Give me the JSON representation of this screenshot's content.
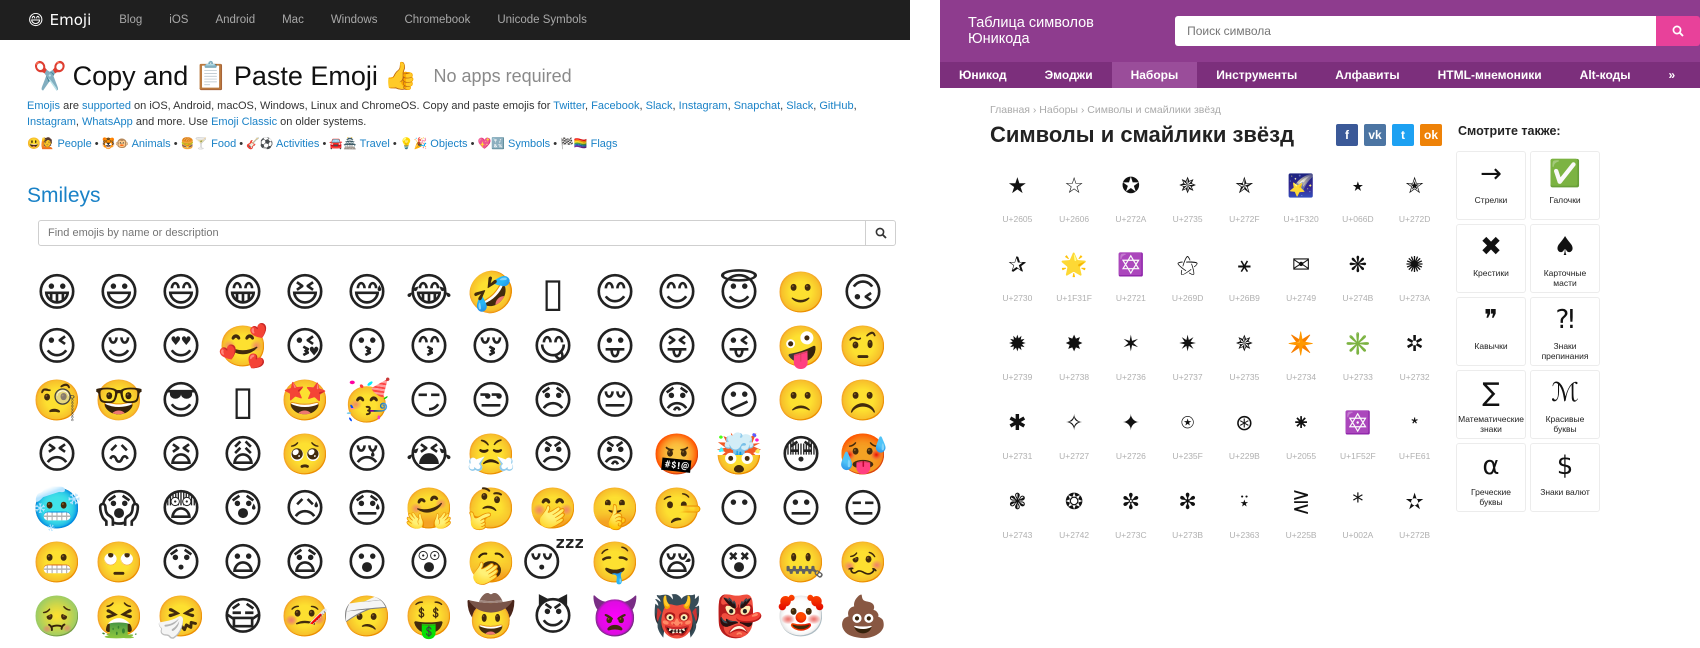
{
  "left": {
    "nav": {
      "brand_icon": "😄",
      "brand": "Emoji",
      "links": [
        "Blog",
        "iOS",
        "Android",
        "Mac",
        "Windows",
        "Chromebook",
        "Unicode Symbols"
      ]
    },
    "header": {
      "icon_scissors": "✂️",
      "word_copy": "Copy and",
      "icon_clipboard": "📋",
      "word_paste": "Paste Emoji",
      "icon_thumb": "👍",
      "note": "No apps required"
    },
    "intro": {
      "emojis": "Emojis",
      "are": " are ",
      "supported": "supported",
      "rest1": " on iOS, Android, macOS, Windows, Linux and ChromeOS. Copy and paste emojis for ",
      "links": [
        "Twitter",
        "Facebook",
        "Slack",
        "Instagram",
        "Snapchat",
        "Slack",
        "GitHub",
        "Instagram",
        "WhatsApp"
      ],
      "rest2": " and more. Use ",
      "classic": "Emoji Classic",
      "rest3": " on older systems."
    },
    "categories": [
      {
        "icons": "😃🙋",
        "label": "People"
      },
      {
        "icons": "🐯🐵",
        "label": "Animals"
      },
      {
        "icons": "🍔🍸",
        "label": "Food"
      },
      {
        "icons": "🎸⚽",
        "label": "Activities"
      },
      {
        "icons": "🚘🏯",
        "label": "Travel"
      },
      {
        "icons": "💡🎉",
        "label": "Objects"
      },
      {
        "icons": "💖🔣",
        "label": "Symbols"
      },
      {
        "icons": "🏁🏳️‍🌈",
        "label": "Flags"
      }
    ],
    "section_title": "Smileys",
    "search_placeholder": "Find emojis by name or description",
    "emoji_rows": [
      [
        "😀",
        "😃",
        "😄",
        "😁",
        "😆",
        "😅",
        "😂",
        "🤣",
        "▯",
        "😊",
        "😊",
        "😇",
        "🙂",
        "🙃"
      ],
      [
        "😉",
        "😌",
        "😍",
        "🥰",
        "😘",
        "😗",
        "😙",
        "😚",
        "😋",
        "😛",
        "😝",
        "😜",
        "🤪",
        "🤨"
      ],
      [
        "🧐",
        "🤓",
        "😎",
        "▯",
        "🤩",
        "🥳",
        "😏",
        "😒",
        "😞",
        "😔",
        "😟",
        "😕",
        "🙁",
        "☹️"
      ],
      [
        "😣",
        "😖",
        "😫",
        "😩",
        "🥺",
        "😢",
        "😭",
        "😤",
        "😠",
        "😡",
        "🤬",
        "🤯",
        "😳",
        "🥵"
      ],
      [
        "🥶",
        "😱",
        "😨",
        "😰",
        "😥",
        "😓",
        "🤗",
        "🤔",
        "🤭",
        "🤫",
        "🤥",
        "😶",
        "😐",
        "😑"
      ],
      [
        "😬",
        "🙄",
        "😯",
        "😦",
        "😧",
        "😮",
        "😲",
        "🥱",
        "😴",
        "🤤",
        "😪",
        "😵",
        "🤐",
        "🥴"
      ],
      [
        "🤢",
        "🤮",
        "🤧",
        "😷",
        "🤒",
        "🤕",
        "🤑",
        "🤠",
        "😈",
        "👿",
        "👹",
        "👺",
        "🤡",
        "💩"
      ]
    ]
  },
  "right": {
    "logo": "Таблица символов Юникода",
    "search_placeholder": "Поиск символа",
    "menu": [
      "Юникод",
      "Эмоджи",
      "Наборы",
      "Инструменты",
      "Алфавиты",
      "HTML-мнемоники",
      "Alt-коды",
      "»"
    ],
    "active_menu": "Наборы",
    "breadcrumbs": "Главная › Наборы › Символы и смайлики звёзд",
    "title": "Символы и смайлики звёзд",
    "social": [
      {
        "label": "f",
        "color": "#3b5998"
      },
      {
        "label": "vk",
        "color": "#4c75a3"
      },
      {
        "label": "t",
        "color": "#1da1f2"
      },
      {
        "label": "ok",
        "color": "#ee8208"
      }
    ],
    "symbol_rows": [
      [
        {
          "g": "★",
          "c": "U+2605"
        },
        {
          "g": "☆",
          "c": "U+2606"
        },
        {
          "g": "✪",
          "c": "U+272A"
        },
        {
          "g": "✵",
          "c": "U+2735"
        },
        {
          "g": "✯",
          "c": "U+272F"
        },
        {
          "g": "🌠",
          "c": "U+1F320"
        },
        {
          "g": "٭",
          "c": "U+066D"
        },
        {
          "g": "✭",
          "c": "U+272D"
        }
      ],
      [
        {
          "g": "✰",
          "c": "U+2730"
        },
        {
          "g": "🌟",
          "c": "U+1F31F"
        },
        {
          "g": "✡️",
          "c": "U+2721"
        },
        {
          "g": "⚝",
          "c": "U+269D"
        },
        {
          "g": "⚹",
          "c": "U+26B9"
        },
        {
          "g": "✉",
          "c": "U+2749"
        },
        {
          "g": "❋",
          "c": "U+274B"
        },
        {
          "g": "✺",
          "c": "U+273A"
        }
      ],
      [
        {
          "g": "✹",
          "c": "U+2739"
        },
        {
          "g": "✸",
          "c": "U+2738"
        },
        {
          "g": "✶",
          "c": "U+2736"
        },
        {
          "g": "✷",
          "c": "U+2737"
        },
        {
          "g": "✵",
          "c": "U+2735"
        },
        {
          "g": "✴️",
          "c": "U+2734"
        },
        {
          "g": "✳️",
          "c": "U+2733"
        },
        {
          "g": "✲",
          "c": "U+2732"
        }
      ],
      [
        {
          "g": "✱",
          "c": "U+2731"
        },
        {
          "g": "✧",
          "c": "U+2727"
        },
        {
          "g": "✦",
          "c": "U+2726"
        },
        {
          "g": "⍟",
          "c": "U+235F"
        },
        {
          "g": "⊛",
          "c": "U+229B"
        },
        {
          "g": "⁕",
          "c": "U+2055"
        },
        {
          "g": "🔯",
          "c": "U+1F52F"
        },
        {
          "g": "﹡",
          "c": "U+FE61"
        }
      ],
      [
        {
          "g": "❃",
          "c": "U+2743"
        },
        {
          "g": "❂",
          "c": "U+2742"
        },
        {
          "g": "✼",
          "c": "U+273C"
        },
        {
          "g": "✻",
          "c": "U+273B"
        },
        {
          "g": "⍣",
          "c": "U+2363"
        },
        {
          "g": "⋛",
          "c": "U+225B"
        },
        {
          "g": "*",
          "c": "U+002A"
        },
        {
          "g": "✫",
          "c": "U+272B"
        }
      ]
    ],
    "see_also": "Смотрите также:",
    "see_cards": [
      {
        "icon": "→",
        "label": "Стрелки"
      },
      {
        "icon": "✅",
        "label": "Галочки"
      },
      {
        "icon": "✖",
        "label": "Крестики"
      },
      {
        "icon": "♠",
        "label": "Карточные масти"
      },
      {
        "icon": "❞",
        "label": "Кавычки"
      },
      {
        "icon": "⁈",
        "label": "Знаки препинания"
      },
      {
        "icon": "∑",
        "label": "Математические знаки"
      },
      {
        "icon": "ℳ",
        "label": "Красивые буквы"
      },
      {
        "icon": "α",
        "label": "Греческие буквы"
      },
      {
        "icon": "$",
        "label": "Знаки валют"
      }
    ]
  }
}
